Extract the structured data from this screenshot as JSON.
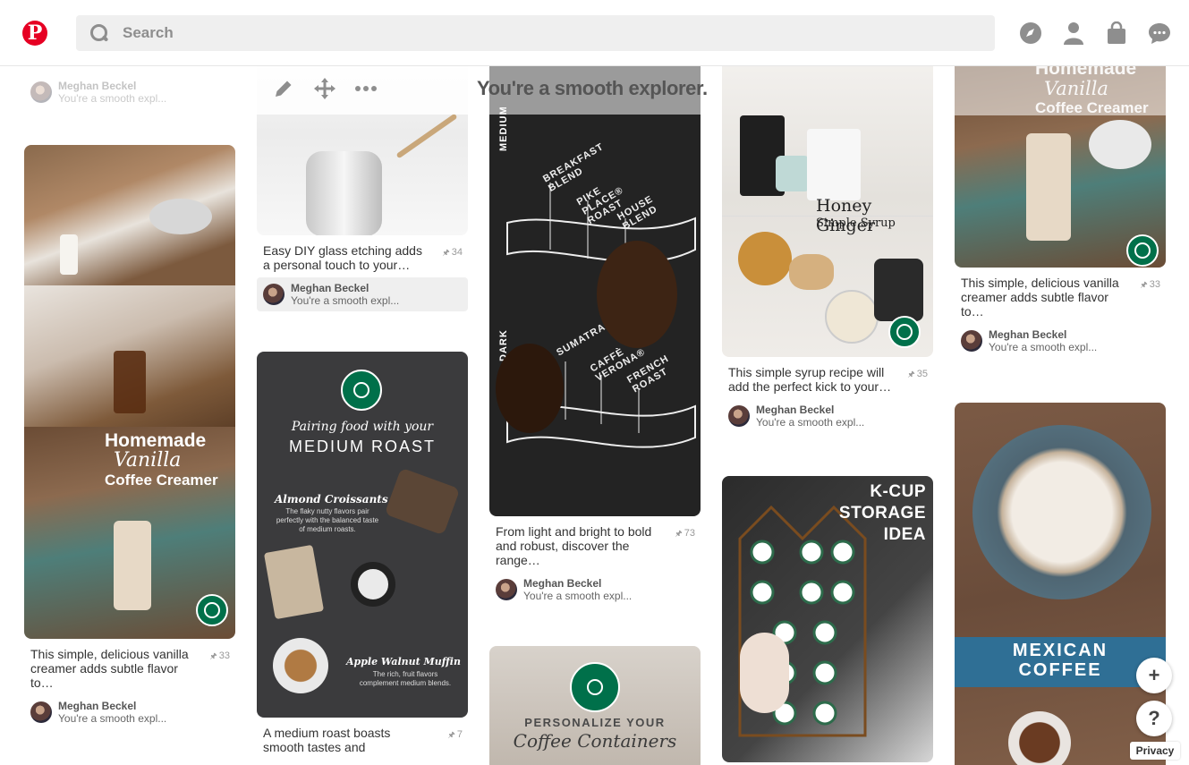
{
  "header": {
    "search_placeholder": "Search",
    "icons": [
      "pinterest-logo",
      "search-icon",
      "explore-compass-icon",
      "profile-icon",
      "shopping-bag-icon",
      "messages-icon"
    ]
  },
  "hover_board_title": "You're a smooth explorer.",
  "colors": {
    "brand": "#e60023",
    "starbucks_green": "#00704a"
  },
  "col1": {
    "top_attr": {
      "name": "Meghan Beckel",
      "board": "You're a smooth expl..."
    },
    "pin": {
      "title_line1": "Homemade",
      "title_line2": "Vanilla",
      "title_line3": "Coffee Creamer",
      "desc": "This simple, delicious vanilla creamer adds subtle flavor to…",
      "count": "33",
      "attr": {
        "name": "Meghan Beckel",
        "board": "You're a smooth expl..."
      }
    }
  },
  "col2": {
    "pin1": {
      "desc": "Easy DIY glass etching adds a personal touch to your…",
      "count": "34",
      "attr": {
        "name": "Meghan Beckel",
        "board": "You're a smooth expl..."
      }
    },
    "pin2": {
      "heading1": "Pairing food with your",
      "heading2": "MEDIUM ROAST",
      "item1_title": "Almond Croissants",
      "item1_text": "The flaky nutty flavors pair perfectly with the balanced taste of medium roasts.",
      "item2_title": "Apple Walnut Muffin",
      "item2_text": "The rich, fruit flavors complement medium blends.",
      "desc": "A medium roast boasts smooth tastes and",
      "count": "7"
    }
  },
  "col3": {
    "pin1": {
      "label_medium": "MEDIUM",
      "label_dark": "DARK",
      "roasts_top": [
        "BREAKFAST BLEND",
        "PIKE PLACE® ROAST",
        "HOUSE BLEND"
      ],
      "roasts_bottom": [
        "SUMATRA",
        "CAFFÈ VERONA®",
        "FRENCH ROAST"
      ],
      "desc": "From light and bright to bold and robust, discover the range…",
      "count": "73",
      "attr": {
        "name": "Meghan Beckel",
        "board": "You're a smooth expl..."
      }
    },
    "pin2": {
      "text1": "PERSONALIZE YOUR",
      "text2": "Coffee Containers"
    }
  },
  "col4": {
    "pin1": {
      "title1": "Honey Ginger",
      "title2": "Simple Syrup",
      "desc": "This simple syrup recipe will add the perfect kick to your…",
      "count": "35",
      "attr": {
        "name": "Meghan Beckel",
        "board": "You're a smooth expl..."
      }
    },
    "pin2": {
      "t1": "K-CUP",
      "t2": "STORAGE",
      "t3": "IDEA"
    }
  },
  "col5": {
    "pin1": {
      "title_line1": "Homemade",
      "title_line2": "Vanilla",
      "title_line3": "Coffee Creamer",
      "desc": "This simple, delicious vanilla creamer adds subtle flavor to…",
      "count": "33",
      "attr": {
        "name": "Meghan Beckel",
        "board": "You're a smooth expl..."
      }
    },
    "pin2": {
      "t1": "MEXICAN",
      "t2": "COFFEE"
    }
  },
  "fab": {
    "add": "+",
    "help": "?",
    "privacy": "Privacy"
  }
}
